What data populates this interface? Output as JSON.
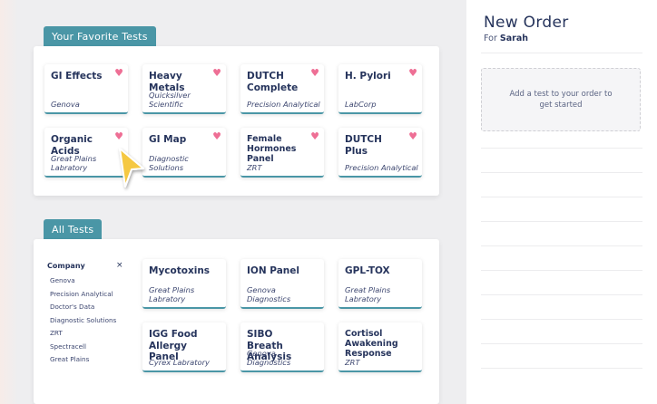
{
  "favorites_section": {
    "tab_label": "Your Favorite Tests",
    "cards": [
      {
        "name": "GI Effects",
        "lab": "Genova",
        "favorite": true
      },
      {
        "name": "Heavy Metals",
        "lab": "Quicksilver Scientific",
        "favorite": true
      },
      {
        "name": "DUTCH Complete",
        "lab": "Precision Analytical",
        "favorite": true
      },
      {
        "name": "H. Pylori",
        "lab": "LabCorp",
        "favorite": true
      },
      {
        "name": "Organic Acids",
        "lab": "Great Plains Labratory",
        "favorite": true
      },
      {
        "name": "GI Map",
        "lab": "Diagnostic Solutions",
        "favorite": true
      },
      {
        "name": "Female Hormones Panel",
        "lab": "ZRT",
        "favorite": true
      },
      {
        "name": "DUTCH Plus",
        "lab": "Precision Analytical",
        "favorite": true
      }
    ]
  },
  "all_tests_section": {
    "tab_label": "All Tests",
    "filter": {
      "heading": "Company",
      "close_glyph": "×",
      "companies": [
        "Genova",
        "Precision Analytical",
        "Doctor's Data",
        "Diagnostic Solutions",
        "ZRT",
        "Spectracell",
        "Great Plains"
      ]
    },
    "cards": [
      {
        "name": "Mycotoxins",
        "lab": "Great Plains Labratory"
      },
      {
        "name": "ION Panel",
        "lab": "Genova Diagnostics"
      },
      {
        "name": "GPL-TOX",
        "lab": "Great Plains Labratory"
      },
      {
        "name": "IGG Food Allergy Panel",
        "lab": "Cyrex Labratory"
      },
      {
        "name": "SIBO Breath Analysis",
        "lab": "Genova Diagnostics"
      },
      {
        "name": "Cortisol Awakening Response",
        "lab": "ZRT"
      }
    ]
  },
  "order_panel": {
    "title": "New Order",
    "for_prefix": "For",
    "patient_name": "Sarah",
    "empty_message": "Add a test to your order to get started"
  },
  "heart_glyph": "♥",
  "colors": {
    "accent": "#4a96a6",
    "navy": "#26345c",
    "heart": "#ee6f95",
    "cursor": "#f5c842"
  }
}
